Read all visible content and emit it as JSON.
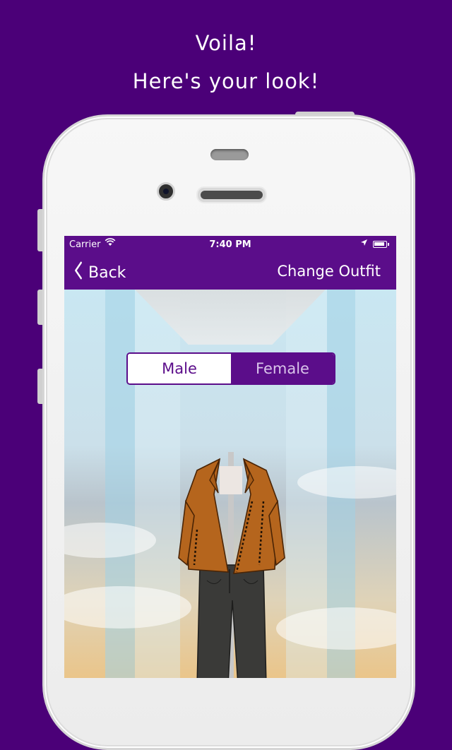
{
  "promo": {
    "line1": "Voila!",
    "line2": "Here's your look!"
  },
  "statusbar": {
    "carrier": "Carrier",
    "time": "7:40 PM"
  },
  "navbar": {
    "back_label": "Back",
    "right_label": "Change Outfit"
  },
  "segment": {
    "options": [
      "Male",
      "Female"
    ],
    "selected": "Male"
  },
  "colors": {
    "background": "#4b0078",
    "brand_purple": "#5b0d8a",
    "jacket": "#b5651d",
    "pants": "#3a3a38"
  },
  "icons": [
    "wifi-icon",
    "location-arrow-icon",
    "battery-icon",
    "chevron-left-icon"
  ]
}
